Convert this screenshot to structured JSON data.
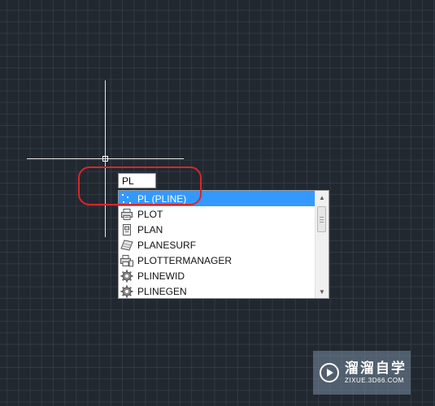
{
  "command_input": {
    "value": "PL"
  },
  "autocomplete": {
    "items": [
      {
        "label": "PL (PLINE)",
        "icon": "polyline-icon",
        "selected": true
      },
      {
        "label": "PLOT",
        "icon": "printer-icon",
        "selected": false
      },
      {
        "label": "PLAN",
        "icon": "plan-view-icon",
        "selected": false
      },
      {
        "label": "PLANESURF",
        "icon": "plane-surface-icon",
        "selected": false
      },
      {
        "label": "PLOTTERMANAGER",
        "icon": "plotter-manager-icon",
        "selected": false
      },
      {
        "label": "PLINEWID",
        "icon": "gear-icon",
        "selected": false
      },
      {
        "label": "PLINEGEN",
        "icon": "gear-icon",
        "selected": false
      }
    ],
    "scrollbar": {
      "up_arrow": "▲",
      "down_arrow": "▼"
    }
  },
  "watermark": {
    "title": "溜溜自学",
    "url": "ZIXUE.3D66.COM",
    "logo": "play-circle-icon"
  },
  "colors": {
    "canvas_background": "#212830",
    "grid_line": "#3e4652",
    "selection": "#3399ff",
    "highlight_outline": "#d8262b",
    "crosshair": "#e7e7e7"
  }
}
